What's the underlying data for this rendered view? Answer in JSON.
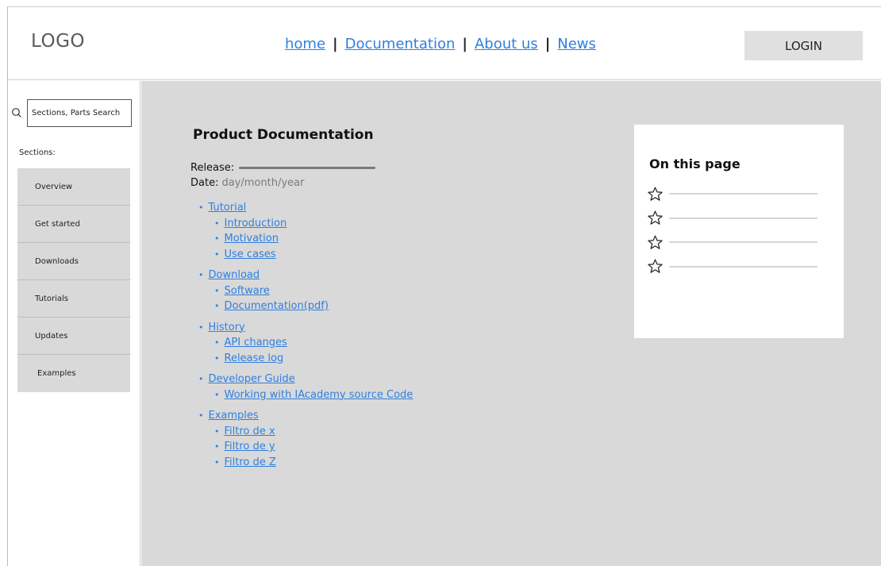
{
  "header": {
    "logo": "LOGO",
    "nav": [
      {
        "label": "home"
      },
      {
        "label": "Documentation"
      },
      {
        "label": "About us"
      },
      {
        "label": "News"
      }
    ],
    "nav_separator": "|",
    "login_label": "LOGIN"
  },
  "sidebar": {
    "search_placeholder": "Sections, Parts Search",
    "search_icon": "search-icon",
    "sections_label": "Sections:",
    "items": [
      {
        "label": "Overview"
      },
      {
        "label": "Get started"
      },
      {
        "label": "Downloads"
      },
      {
        "label": "Tutorials"
      },
      {
        "label": "Updates"
      },
      {
        "label": "Examples"
      }
    ]
  },
  "main": {
    "title": "Product Documentation",
    "release_label": "Release:",
    "date_label": "Date:",
    "date_value": "day/month/year",
    "toc": [
      {
        "label": "Tutorial",
        "children": [
          {
            "label": "Introduction"
          },
          {
            "label": "Motivation"
          },
          {
            "label": "Use cases"
          }
        ]
      },
      {
        "label": "Download",
        "children": [
          {
            "label": "Software"
          },
          {
            "label": "Documentation(pdf)"
          }
        ]
      },
      {
        "label": "History",
        "children": [
          {
            "label": "API changes"
          },
          {
            "label": "Release log"
          }
        ]
      },
      {
        "label": "Developer Guide",
        "children": [
          {
            "label": "Working with IAcademy source Code"
          }
        ]
      },
      {
        "label": "Examples",
        "children": [
          {
            "label": "Filtro de x"
          },
          {
            "label": "Filtro de y"
          },
          {
            "label": "Filtro de Z"
          }
        ]
      }
    ],
    "bullet": "•"
  },
  "on_this_page": {
    "title": "On this page",
    "item_icon": "star-icon",
    "item_count": 4
  },
  "colors": {
    "link": "#2f7fe0",
    "main_bg": "#d9d9d9",
    "sidebar_item_bg": "#d9d9d9",
    "login_bg": "#e0e0e0"
  }
}
